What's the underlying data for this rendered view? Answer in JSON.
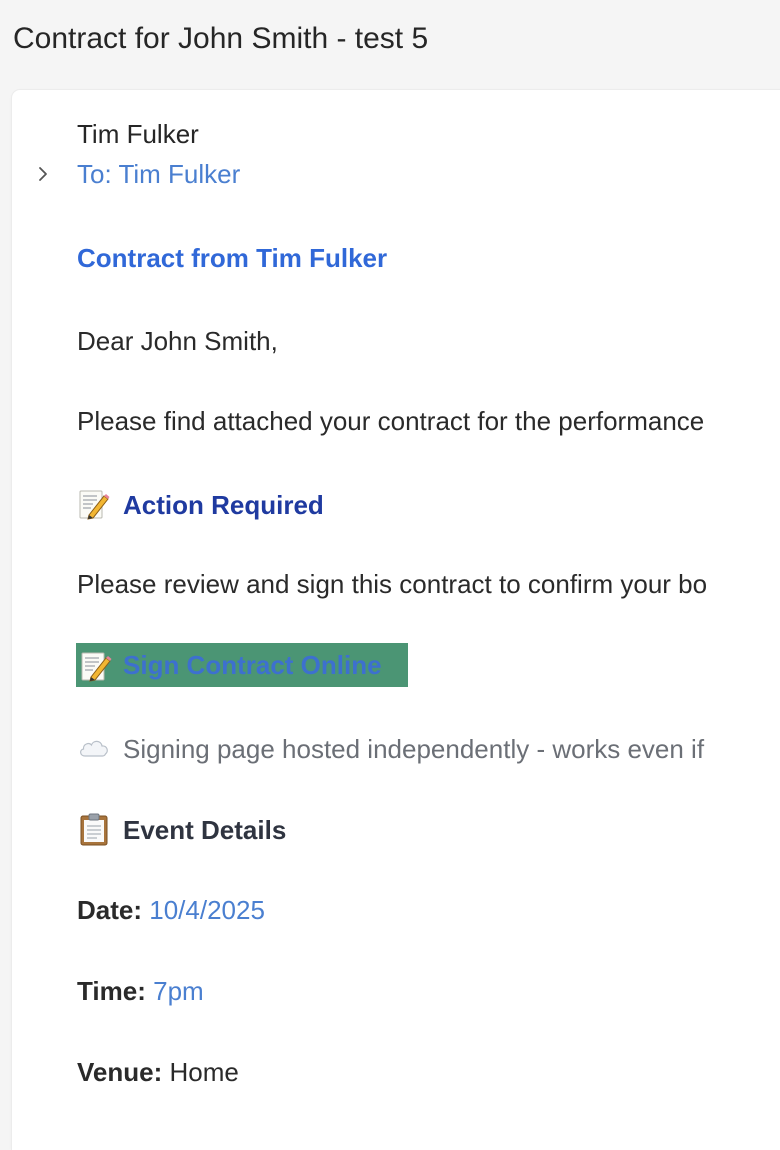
{
  "window": {
    "subject": "Contract for John Smith - test 5"
  },
  "header": {
    "from_name": "Tim Fulker",
    "to_line": "To: Tim Fulker"
  },
  "body": {
    "heading": "Contract from Tim Fulker",
    "greeting": "Dear John Smith,",
    "intro": "Please find attached your contract for the performance",
    "action_heading": "Action Required",
    "review_text": "Please review and sign this contract to confirm your bo",
    "sign_button_label": "Sign Contract Online",
    "hosted_note": "Signing page hosted independently - works even if",
    "event_heading": "Event Details",
    "details": {
      "date_label": "Date:",
      "date_value": "10/4/2025",
      "time_label": "Time:",
      "time_value": "7pm",
      "venue_label": "Venue:",
      "venue_value": "Home"
    }
  },
  "icons": {
    "expand": "chevron-right-icon",
    "memo": "memo-pencil-icon",
    "cloud": "cloud-icon",
    "clipboard": "clipboard-icon"
  },
  "colors": {
    "link_blue": "#4a7fd0",
    "heading_blue": "#3068d8",
    "action_blue": "#1f3aa0",
    "sign_button_bg": "#4b9574"
  }
}
